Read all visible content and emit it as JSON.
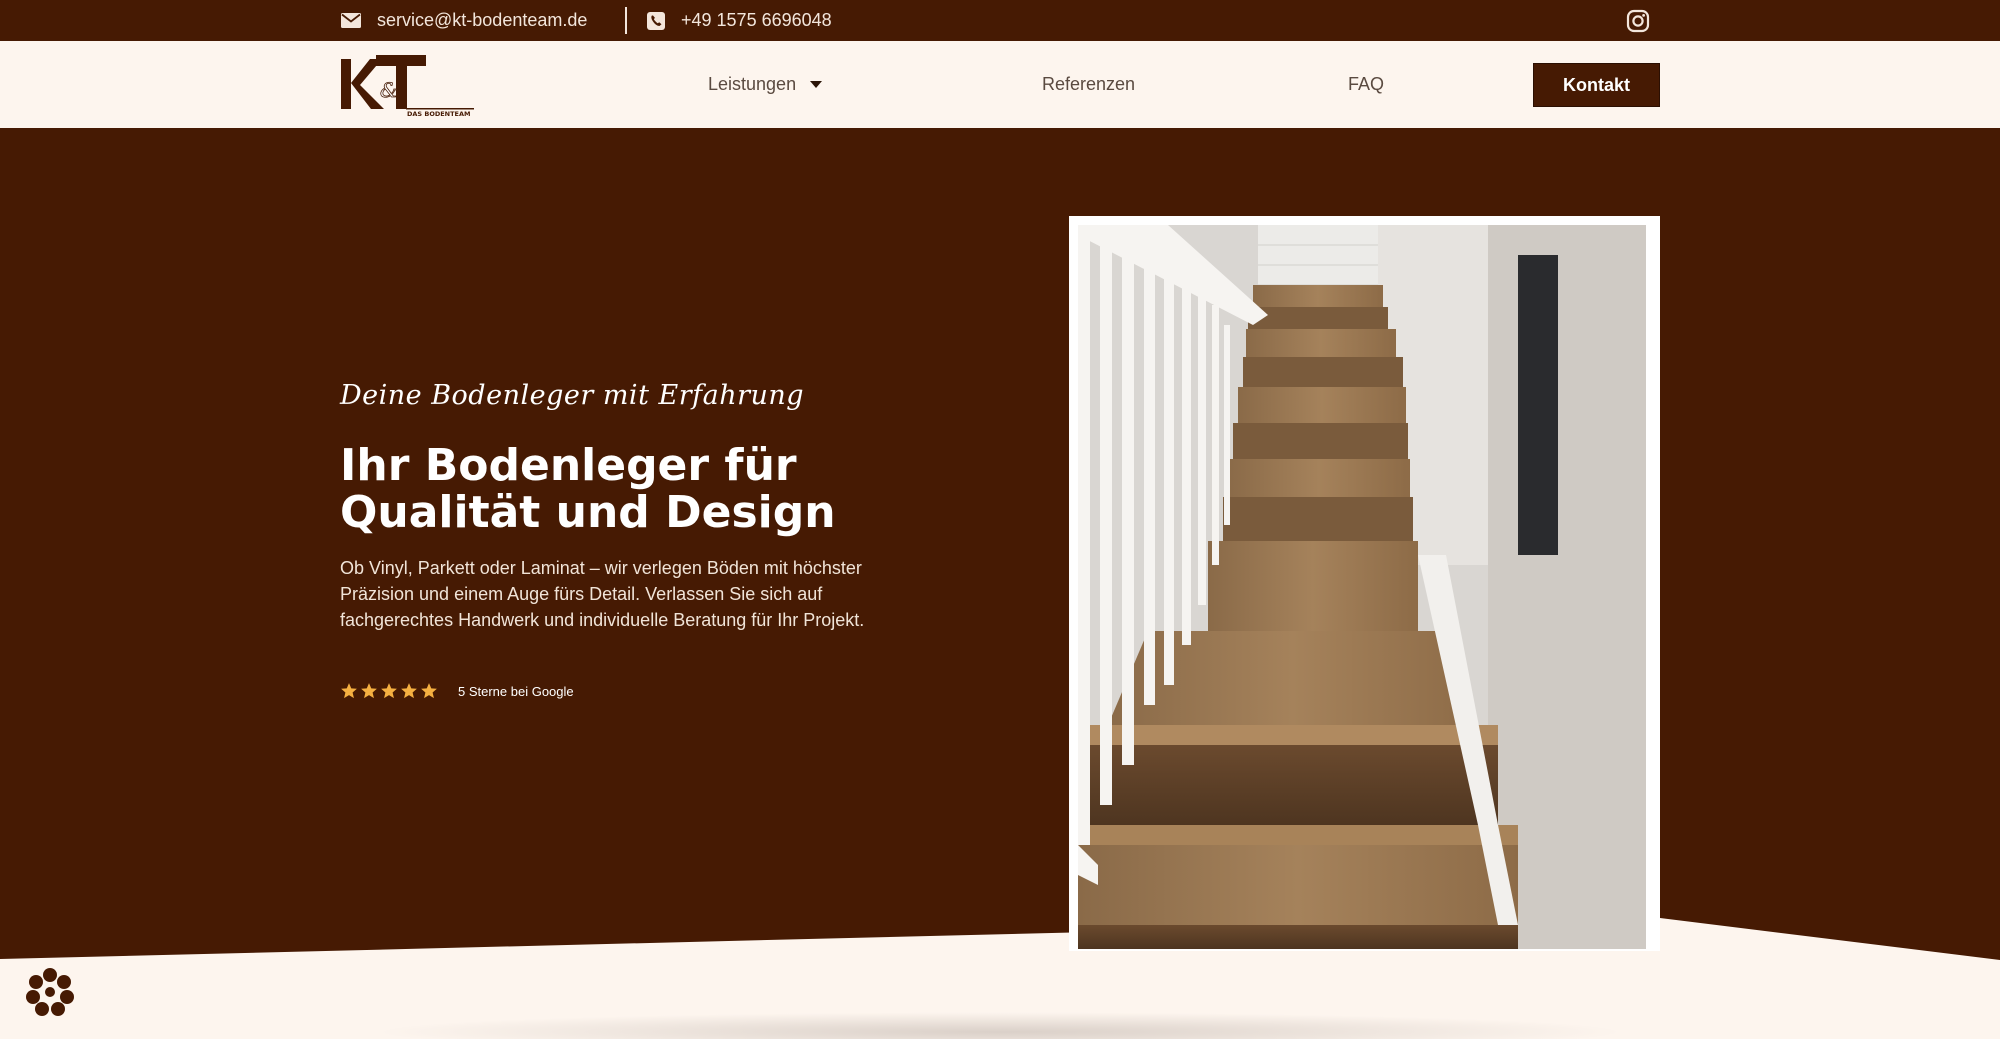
{
  "topbar": {
    "email": "service@kt-bodenteam.de",
    "phone": "+49 1575 6696048",
    "email_icon": "envelope-icon",
    "phone_icon": "phone-icon",
    "social_icon": "instagram-icon"
  },
  "nav": {
    "logo_alt": "K&T Das Bodenteam",
    "items": [
      {
        "label": "Leistungen",
        "has_dropdown": true
      },
      {
        "label": "Referenzen"
      },
      {
        "label": "FAQ"
      }
    ],
    "cta_label": "Kontakt"
  },
  "hero": {
    "tagline": "Deine Bodenleger mit Erfahrung",
    "headline_line1": "Ihr Bodenleger für",
    "headline_line2": "Qualität und Design",
    "lead": "Ob Vinyl, Parkett oder Laminat – wir verlegen Böden mit höchster Präzision und einem Auge fürs Detail. Verlassen Sie sich auf fachgerechtes Handwerk und individuelle Beratung für Ihr Projekt.",
    "rating_stars": 5,
    "rating_text": "5 Sterne bei Google"
  },
  "colors": {
    "brand_dark": "#461a03",
    "cream": "#fdf5ee",
    "star": "#f5b041"
  }
}
